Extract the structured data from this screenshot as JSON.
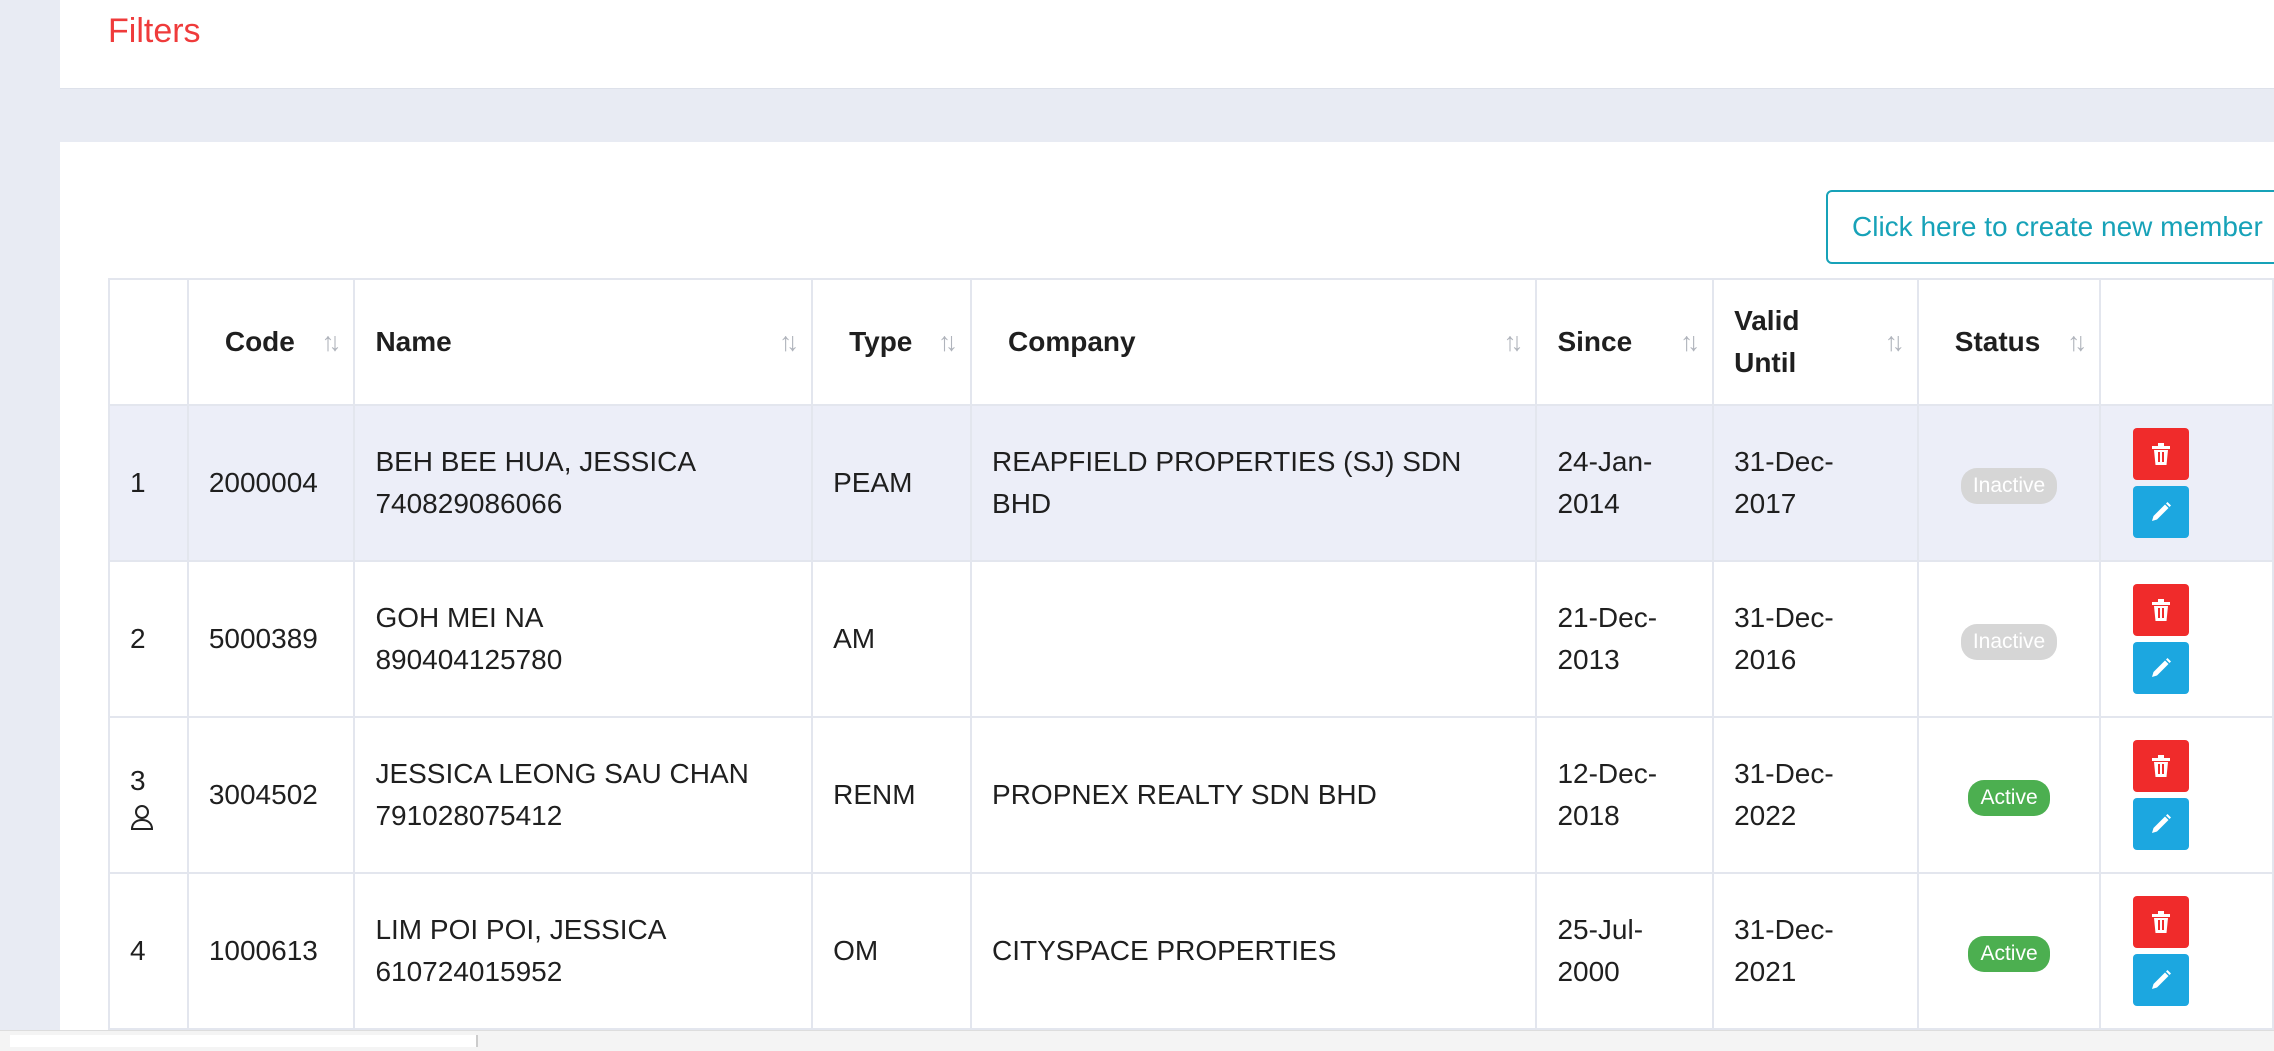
{
  "filters": {
    "title": "Filters"
  },
  "create_button": {
    "label": "Click here to create new member"
  },
  "table": {
    "columns": [
      {
        "key": "no",
        "label": ""
      },
      {
        "key": "code",
        "label": "Code"
      },
      {
        "key": "name",
        "label": "Name"
      },
      {
        "key": "type",
        "label": "Type"
      },
      {
        "key": "company",
        "label": "Company"
      },
      {
        "key": "since",
        "label": "Since"
      },
      {
        "key": "valid_until",
        "label": "Valid Until"
      },
      {
        "key": "status",
        "label": "Status"
      },
      {
        "key": "actions",
        "label": ""
      }
    ],
    "rows": [
      {
        "no": "1",
        "code": "2000004",
        "name": "BEH BEE HUA, JESSICA",
        "ic": "740829086066",
        "type": "PEAM",
        "company": "REAPFIELD PROPERTIES (SJ) SDN BHD",
        "since_a": "24-Jan-",
        "since_b": "2014",
        "valid_a": "31-Dec-",
        "valid_b": "2017",
        "status": "Inactive"
      },
      {
        "no": "2",
        "code": "5000389",
        "name": "GOH MEI NA",
        "ic": "890404125780",
        "type": "AM",
        "company": "",
        "since_a": "21-Dec-",
        "since_b": "2013",
        "valid_a": "31-Dec-",
        "valid_b": "2016",
        "status": "Inactive"
      },
      {
        "no": "3",
        "code": "3004502",
        "name": "JESSICA LEONG SAU CHAN",
        "ic": "791028075412",
        "type": "RENM",
        "company": "PROPNEX REALTY SDN BHD",
        "since_a": "12-Dec-",
        "since_b": "2018",
        "valid_a": "31-Dec-",
        "valid_b": "2022",
        "status": "Active"
      },
      {
        "no": "4",
        "code": "1000613",
        "name": "LIM POI POI, JESSICA",
        "ic": "610724015952",
        "type": "OM",
        "company": "CITYSPACE PROPERTIES",
        "since_a": "25-Jul-",
        "since_b": "2000",
        "valid_a": "31-Dec-",
        "valid_b": "2021",
        "status": "Active"
      }
    ]
  },
  "icons": {
    "sort": "sort-arrows-icon",
    "delete": "trash-icon",
    "edit": "pencil-icon",
    "user": "user-icon"
  },
  "colors": {
    "accent_red": "#ef3b3b",
    "teal": "#17a2b8",
    "delete": "#f02b2b",
    "edit": "#1ca7e0",
    "active": "#4caf50",
    "inactive": "#d6d6d6"
  }
}
